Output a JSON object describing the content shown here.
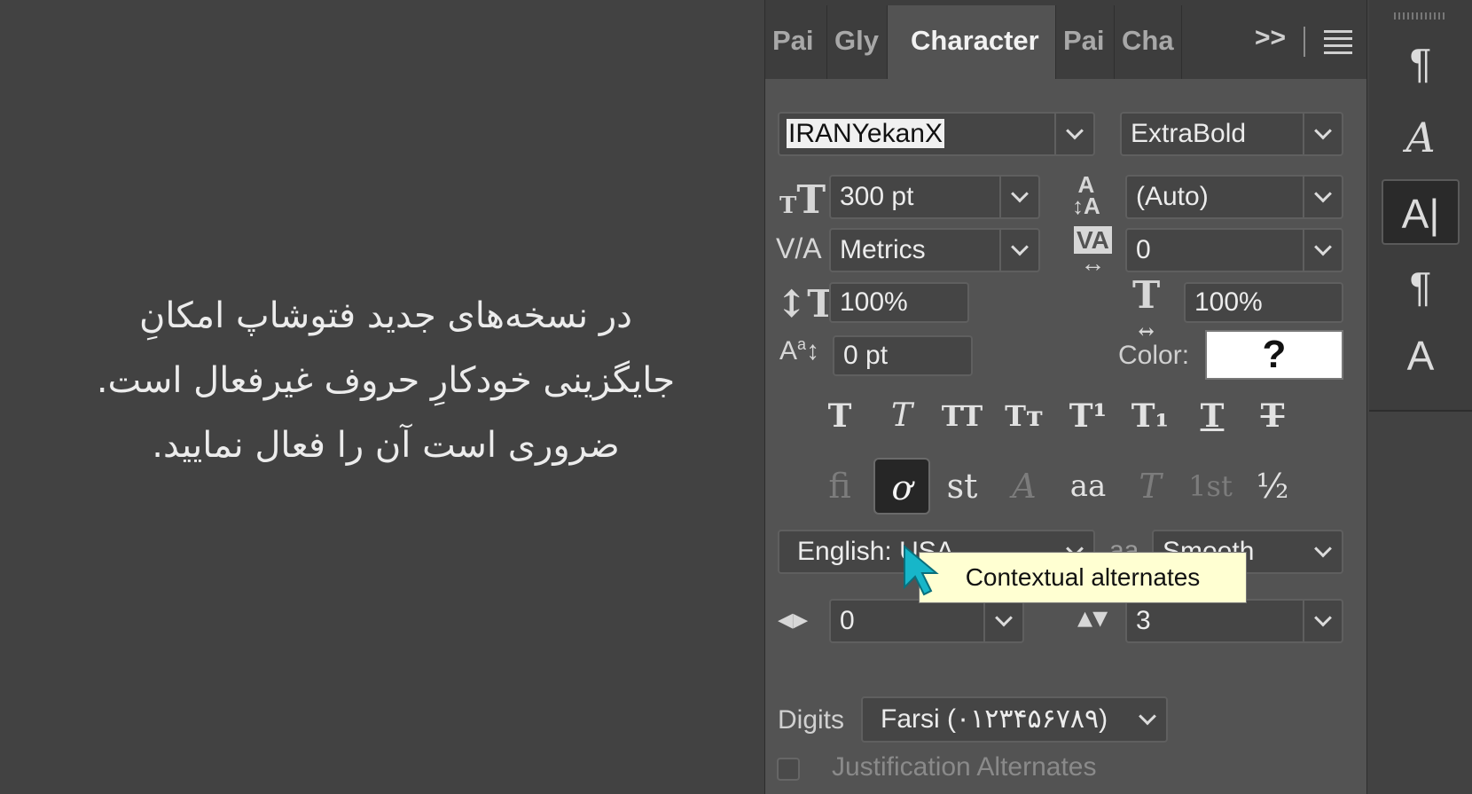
{
  "caption": {
    "lines": [
      "در نسخه‌های جدید فتوشاپ امکانِ",
      "جایگزینی خودکارِ حروف غیرفعال است.",
      "ضروری است آن را فعال نمایید."
    ]
  },
  "tabs": [
    "Pai",
    "Gly",
    "Character",
    "Pai",
    "Cha"
  ],
  "tab_more": ">>",
  "font": {
    "family": "IRANYekanX",
    "style": "ExtraBold"
  },
  "size": {
    "value": "300 pt"
  },
  "leading": {
    "value": "(Auto)"
  },
  "kerning": {
    "value": "Metrics"
  },
  "tracking": {
    "value": "0"
  },
  "vertical_scale": {
    "value": "100%"
  },
  "horizontal_scale": {
    "value": "100%"
  },
  "baseline_shift": {
    "value": "0 pt"
  },
  "color": {
    "label": "Color:",
    "swatch": "?"
  },
  "type_styles": [
    "T",
    "T",
    "TT",
    "Tт",
    "T¹",
    "T₁",
    "T",
    "T"
  ],
  "opentype": [
    "fi",
    "ơ",
    "st",
    "A",
    "aa",
    "T",
    "1st",
    "½"
  ],
  "language": {
    "value": "English: USA"
  },
  "antialias": {
    "icon": "aa",
    "value": "Smooth"
  },
  "tooltip": "Contextual alternates",
  "kashida_left": {
    "value": "0"
  },
  "kashida_right": {
    "value": "3"
  },
  "digits": {
    "label": "Digits",
    "value": "Farsi (۰۱۲۳۴۵۶۷۸۹)"
  },
  "justification": {
    "label": "Justification Alternates"
  },
  "strip_icons": [
    "¶",
    "A",
    "A|",
    "¶",
    "A"
  ]
}
